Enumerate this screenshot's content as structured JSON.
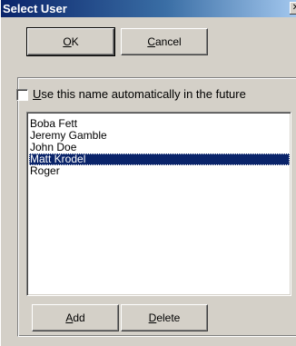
{
  "window": {
    "title": "Select User",
    "close_glyph": "✕"
  },
  "buttons": {
    "ok": {
      "mnemonic": "O",
      "rest": "K"
    },
    "cancel": {
      "mnemonic": "C",
      "rest": "ancel"
    },
    "add": {
      "mnemonic": "A",
      "rest": "dd"
    },
    "delete": {
      "mnemonic": "D",
      "rest": "elete"
    }
  },
  "auto_checkbox": {
    "checked": false,
    "mnemonic": "U",
    "rest": "se this name automatically in the future"
  },
  "user_list": {
    "items": [
      "Boba Fett",
      "Jeremy Gamble",
      "John Doe",
      "Matt Krodel",
      "Roger"
    ],
    "selected_index": 3
  },
  "colors": {
    "dialog_face": "#d4d0c8",
    "titlebar_start": "#0a246a",
    "selection": "#0a246a"
  },
  "icons": {
    "close": "close-icon"
  }
}
